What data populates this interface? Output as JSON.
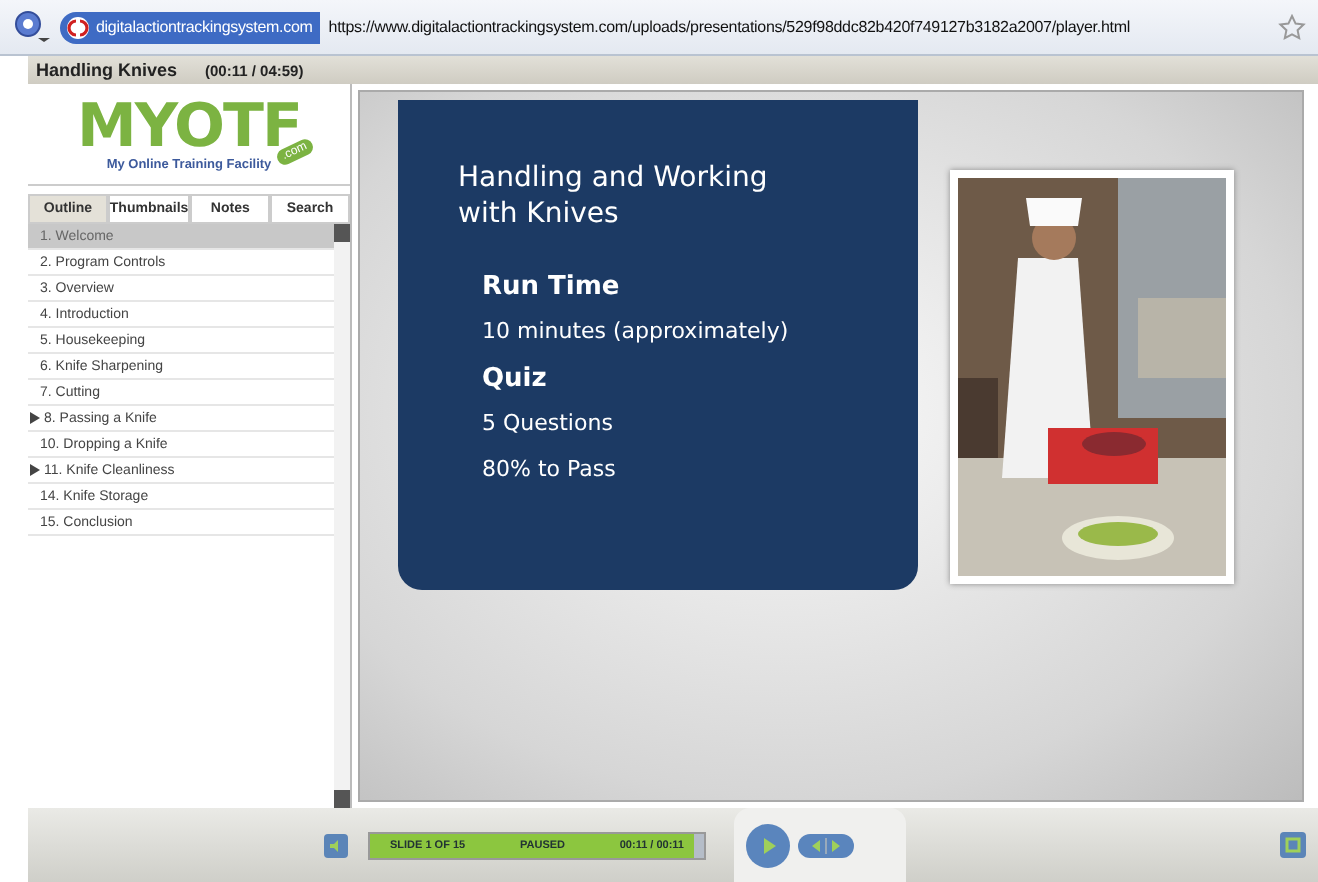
{
  "address_bar": {
    "site_badge": "digitalactiontrackingsystem.com",
    "url": "https://www.digitalactiontrackingsystem.com/uploads/presentations/529f98ddc82b420f749127b3182a2007/player.html"
  },
  "title_bar": {
    "title": "Handling Knives",
    "time": "(00:11 / 04:59)"
  },
  "logo": {
    "letters": "MYOTF",
    "tagline": "My Online Training Facility",
    "badge": ".com"
  },
  "tabs": [
    {
      "label": "Outline",
      "selected": true
    },
    {
      "label": "Thumbnails",
      "selected": false
    },
    {
      "label": "Notes",
      "selected": false
    },
    {
      "label": "Search",
      "selected": false
    }
  ],
  "outline": [
    {
      "label": "1. Welcome",
      "selected": true,
      "expandable": false
    },
    {
      "label": "2. Program Controls",
      "selected": false,
      "expandable": false
    },
    {
      "label": "3. Overview",
      "selected": false,
      "expandable": false
    },
    {
      "label": "4. Introduction",
      "selected": false,
      "expandable": false
    },
    {
      "label": "5. Housekeeping",
      "selected": false,
      "expandable": false
    },
    {
      "label": "6. Knife Sharpening",
      "selected": false,
      "expandable": false
    },
    {
      "label": "7. Cutting",
      "selected": false,
      "expandable": false
    },
    {
      "label": "8. Passing a Knife",
      "selected": false,
      "expandable": true
    },
    {
      "label": "10. Dropping a Knife",
      "selected": false,
      "expandable": false
    },
    {
      "label": "11. Knife Cleanliness",
      "selected": false,
      "expandable": true
    },
    {
      "label": "14. Knife Storage",
      "selected": false,
      "expandable": false
    },
    {
      "label": "15. Conclusion",
      "selected": false,
      "expandable": false
    }
  ],
  "slide": {
    "title": "Handling and Working with Knives",
    "sections": [
      {
        "heading": "Run Time",
        "lines": [
          "10 minutes (approximately)"
        ]
      },
      {
        "heading": "Quiz",
        "lines": [
          "5 Questions",
          "80% to Pass"
        ]
      }
    ]
  },
  "player": {
    "slide_counter": "SLIDE 1 OF 15",
    "status": "PAUSED",
    "time": "00:11 / 00:11",
    "level": 0.97
  }
}
